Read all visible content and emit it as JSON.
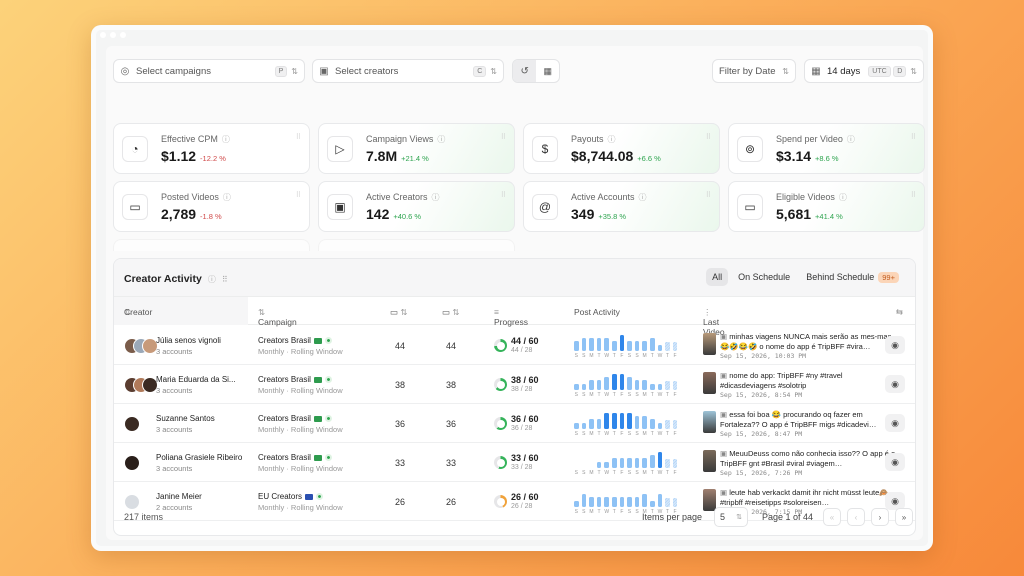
{
  "toolbar": {
    "campaigns_placeholder": "Select campaigns",
    "campaigns_key": "P",
    "creators_placeholder": "Select creators",
    "creators_key": "C",
    "filter_date": "Filter by Date",
    "range": "14 days",
    "tz": "UTC",
    "range_key": "D"
  },
  "metrics": [
    {
      "label": "Effective CPM",
      "value": "$1.12",
      "change": "-12.2 %",
      "icon": "gauge-icon"
    },
    {
      "label": "Campaign Views",
      "value": "7.8M",
      "change": "+21.4 %",
      "icon": "play-icon"
    },
    {
      "label": "Payouts",
      "value": "$8,744.08",
      "change": "+6.6 %",
      "icon": "dollar-icon"
    },
    {
      "label": "Spend per Video",
      "value": "$3.14",
      "change": "+8.6 %",
      "icon": "coins-icon"
    },
    {
      "label": "Posted Videos",
      "value": "2,789",
      "change": "-1.8 %",
      "icon": "video-icon"
    },
    {
      "label": "Active Creators",
      "value": "142",
      "change": "+40.6 %",
      "icon": "contact-icon"
    },
    {
      "label": "Active Accounts",
      "value": "349",
      "change": "+35.8 %",
      "icon": "at-icon"
    },
    {
      "label": "Eligible Videos",
      "value": "5,681",
      "change": "+41.4 %",
      "icon": "video-icon"
    }
  ],
  "activity": {
    "title": "Creator Activity",
    "tabs": [
      "All",
      "On Schedule",
      "Behind Schedule"
    ],
    "behind_count": "99+",
    "columns": {
      "creator": "Creator",
      "campaign": "Campaign",
      "progress": "Progress",
      "post_activity": "Post Activity",
      "last_video": "Last Video"
    },
    "day_letters": [
      "S",
      "S",
      "M",
      "T",
      "W",
      "T",
      "F",
      "S",
      "S",
      "M",
      "T",
      "W",
      "T",
      "F"
    ],
    "rows": [
      {
        "name": "Júlia senos vignoli",
        "accounts": "3 accounts",
        "campaign": "Creators Brasil",
        "window": "Monthly · Rolling Window",
        "a": "44",
        "b": "44",
        "progress": "44 / 60",
        "sub": "44 / 28",
        "pct": 0.73,
        "activity": [
          2,
          3,
          3,
          3,
          3,
          2,
          4,
          2,
          2,
          2,
          3,
          1,
          0,
          0
        ],
        "last_text": "minhas viagens NUNCA mais serão as mes-mas 😂🤣😂🤣 o nome do app é TripBFF #vira…",
        "last_date": "Sep 15, 2026, 10:03 PM"
      },
      {
        "name": "Maria Eduarda da Si...",
        "accounts": "3 accounts",
        "campaign": "Creators Brasil",
        "window": "Monthly · Rolling Window",
        "a": "38",
        "b": "38",
        "progress": "38 / 60",
        "sub": "38 / 28",
        "pct": 0.63,
        "activity": [
          1,
          1,
          2,
          2,
          3,
          4,
          4,
          3,
          2,
          2,
          1,
          1,
          0,
          0
        ],
        "last_text": "nome do app: TripBFF #ny #travel #dicasdeviagens #solotrip",
        "last_date": "Sep 15, 2026, 8:54 PM"
      },
      {
        "name": "Suzanne Santos",
        "accounts": "3 accounts",
        "campaign": "Creators Brasil",
        "window": "Monthly · Rolling Window",
        "a": "36",
        "b": "36",
        "progress": "36 / 60",
        "sub": "36 / 28",
        "pct": 0.6,
        "activity": [
          1,
          1,
          2,
          2,
          4,
          4,
          4,
          4,
          3,
          3,
          2,
          1,
          0,
          0
        ],
        "last_text": "essa foi boa 😂 procurando oq fazer em Fortaleza?? O app é TripBFF migs #dicadevi…",
        "last_date": "Sep 15, 2026, 8:47 PM"
      },
      {
        "name": "Poliana Grasiele Ribeiro",
        "accounts": "3 accounts",
        "campaign": "Creators Brasil",
        "window": "Monthly · Rolling Window",
        "a": "33",
        "b": "33",
        "progress": "33 / 60",
        "sub": "33 / 28",
        "pct": 0.55,
        "activity": [
          0,
          0,
          0,
          1,
          1,
          2,
          2,
          2,
          2,
          2,
          3,
          4,
          0,
          0
        ],
        "last_text": "MeuuDeuss como não conhecia isso?? O app é o TripBFF gnt #Brasil #viral #viagem…",
        "last_date": "Sep 15, 2026, 7:26 PM"
      },
      {
        "name": "Janine Meier",
        "accounts": "2 accounts",
        "campaign": "EU Creators",
        "window": "Monthly · Rolling Window",
        "a": "26",
        "b": "26",
        "progress": "26 / 60",
        "sub": "26 / 28",
        "pct": 0.43,
        "activity": [
          1,
          3,
          2,
          2,
          2,
          2,
          2,
          2,
          2,
          3,
          1,
          3,
          0,
          0
        ],
        "last_text": "leute hab verkackt damit ihr nicht müsst leute🙈 #tripbff #reisetipps #soloreisen…",
        "last_date": "Sep 15, 2026, 7:15 PM"
      }
    ],
    "footer": {
      "items": "217 items",
      "per_page_label": "Items per page",
      "per_page": "5",
      "page": "Page 1 of 44"
    }
  },
  "colors": {
    "accent": "#2f86ea",
    "up": "#2ea44f",
    "down": "#d04a4a",
    "ring": "#35b35a",
    "ring_warn": "#f0a23a"
  }
}
